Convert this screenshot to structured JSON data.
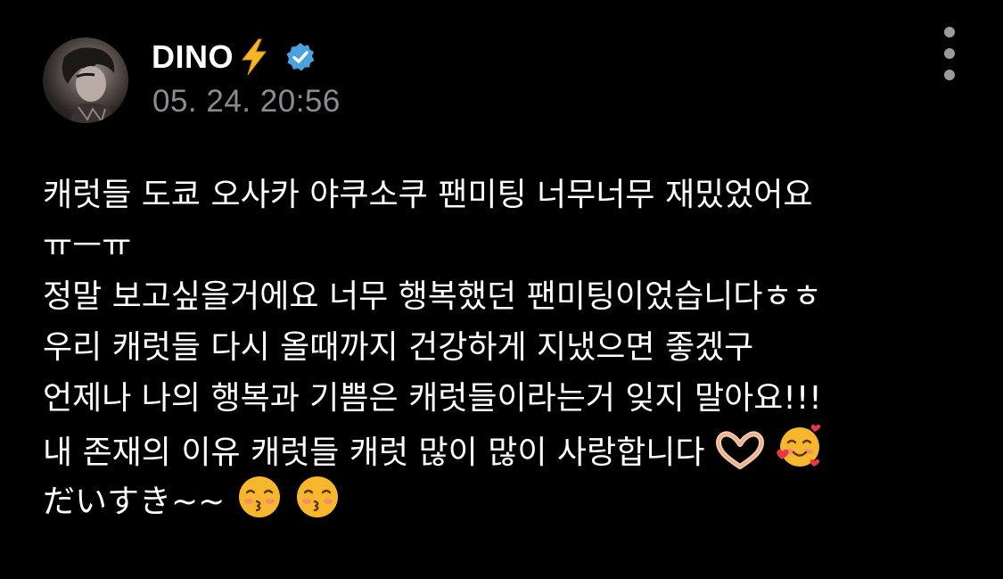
{
  "post": {
    "author": {
      "name": "DINO",
      "name_emoji_icon": "lightning-bolt-icon",
      "verified_icon": "verified-badge-icon",
      "verified_color": "#4aa3df",
      "avatar_icon": "profile-avatar"
    },
    "timestamp": "05. 24. 20:56",
    "more_icon": "vertical-ellipsis-icon",
    "lines": [
      "캐럿들 도쿄 오사카 야쿠소쿠 팬미팅 너무너무 재밌었어요",
      "ㅠㅡㅠ",
      "정말 보고싶을거에요 너무 행복했던 팬미팅이었습니다ㅎㅎ",
      "우리 캐럿들 다시 올때까지 건강하게 지냈으면 좋겠구",
      "언제나 나의 행복과 기쁨은 캐럿들이라는거 잊지 말아요!!!",
      "내 존재의 이유 캐럿들 캐럿 많이 많이 사랑합니다",
      "だいすき~~"
    ],
    "line6_emojis": [
      "heart-hands-icon",
      "smiling-face-with-hearts-icon"
    ],
    "line7_emojis": [
      "kissing-face-icon",
      "kissing-face-icon"
    ]
  },
  "colors": {
    "background": "#000000",
    "text": "#ffffff",
    "muted": "#8c8c90",
    "verified": "#4aa3df",
    "bolt": "#f6b626"
  }
}
